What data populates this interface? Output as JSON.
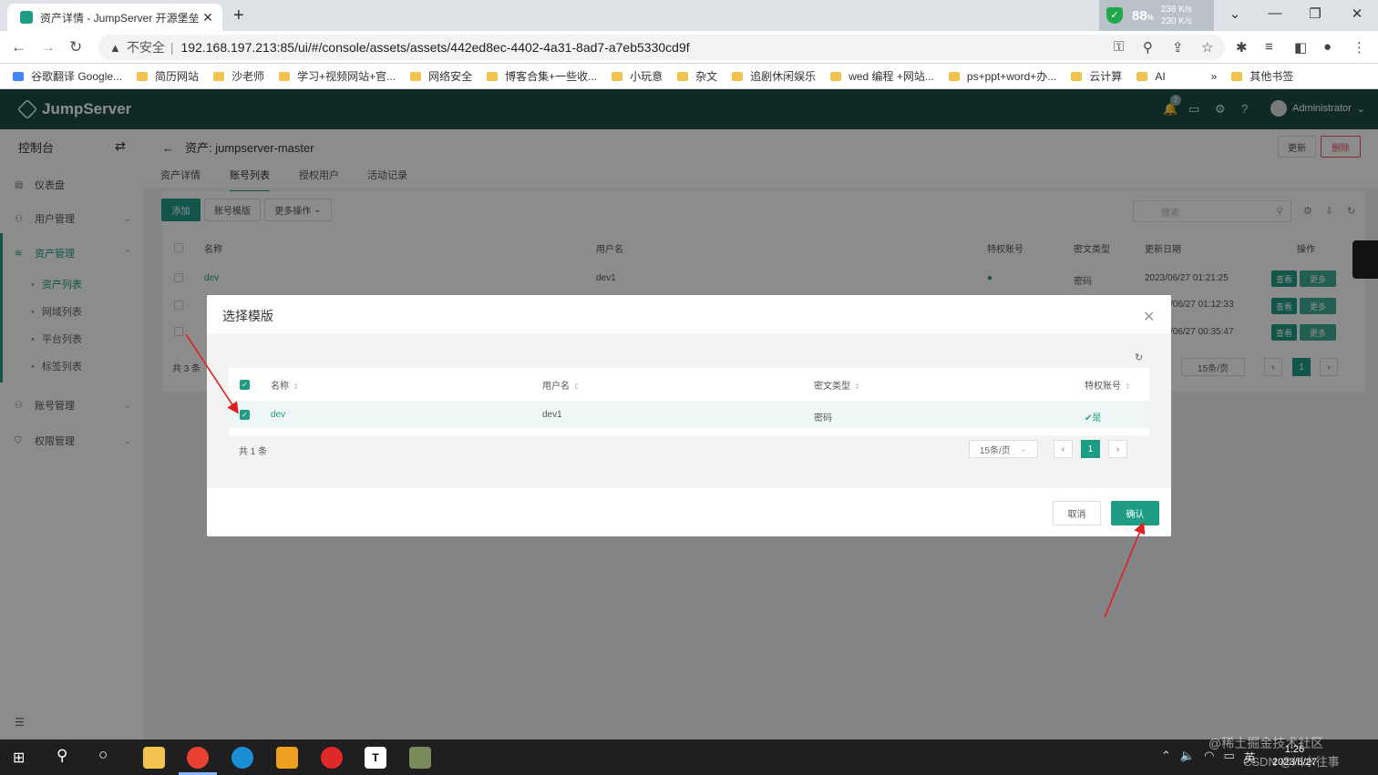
{
  "browser": {
    "tab_title": "资产详情 - JumpServer 开源堡垒",
    "new_tab": "+",
    "net_percent": "88",
    "net_percent_unit": "%",
    "net_up": "236 K/s",
    "net_down": "230 K/s",
    "insecure_label": "不安全",
    "url": "192.168.197.213:85/ui/#/console/assets/assets/442ed8ec-4402-4a31-8ad7-a7eb5330cd9f",
    "bookmarks": [
      "谷歌翻译 Google...",
      "简历网站",
      "沙老师",
      "学习+视频网站+官...",
      "网络安全",
      "博客合集+一些收...",
      "小玩意",
      "杂文",
      "追剧休闲娱乐",
      "wed 编程 +网站...",
      "ps+ppt+word+办...",
      "云计算",
      "AI"
    ],
    "bookmarks_more": "»",
    "other_bookmarks": "其他书签"
  },
  "app": {
    "logo": "JumpServer",
    "notification_count": "2",
    "user": "Administrator"
  },
  "sidebar": {
    "header": "控制台",
    "items": [
      {
        "label": "仪表盘"
      },
      {
        "label": "用户管理"
      },
      {
        "label": "资产管理"
      },
      {
        "label": "账号管理"
      },
      {
        "label": "权限管理"
      }
    ],
    "subitems": [
      "资产列表",
      "网域列表",
      "平台列表",
      "标签列表"
    ]
  },
  "page": {
    "breadcrumb": "资产: jumpserver-master",
    "tabs": [
      "资产详情",
      "账号列表",
      "授权用户",
      "活动记录"
    ],
    "update_btn": "更新",
    "delete_btn": "删除",
    "add_btn": "添加",
    "template_btn": "账号模版",
    "more_btn": "更多操作",
    "search_placeholder": "搜索",
    "columns": [
      "名称",
      "用户名",
      "特权账号",
      "密文类型",
      "更新日期",
      "操作"
    ],
    "rows": [
      {
        "name": "dev",
        "username": "dev1",
        "secret": "密码",
        "date": "2023/06/27 01:21:25"
      },
      {
        "name": "",
        "username": "",
        "secret": "",
        "date": "/06/27 01:12:33"
      },
      {
        "name": "",
        "username": "",
        "secret": "",
        "date": "/06/27 00:35:47"
      }
    ],
    "view_btn": "查看",
    "more_small": "更多",
    "total": "共 3 条",
    "page_size": "15条/页",
    "current_page": "1"
  },
  "dialog": {
    "title": "选择模版",
    "columns": [
      "名称",
      "用户名",
      "密文类型",
      "特权账号"
    ],
    "row": {
      "name": "dev",
      "username": "dev1",
      "secret": "密码",
      "privileged": "是"
    },
    "total": "共 1 条",
    "page_size": "15条/页",
    "current_page": "1",
    "cancel": "取消",
    "confirm": "确认"
  },
  "taskbar": {
    "clock_time": "1:26",
    "clock_date": "2023/6/27",
    "ime": "英",
    "watermark": "@稀土掘金技术社区",
    "watermark2": "CSDN @川水往事"
  },
  "colors": {
    "accent": "#1f9d84",
    "header": "#1d4d46",
    "danger": "#ed5565"
  }
}
